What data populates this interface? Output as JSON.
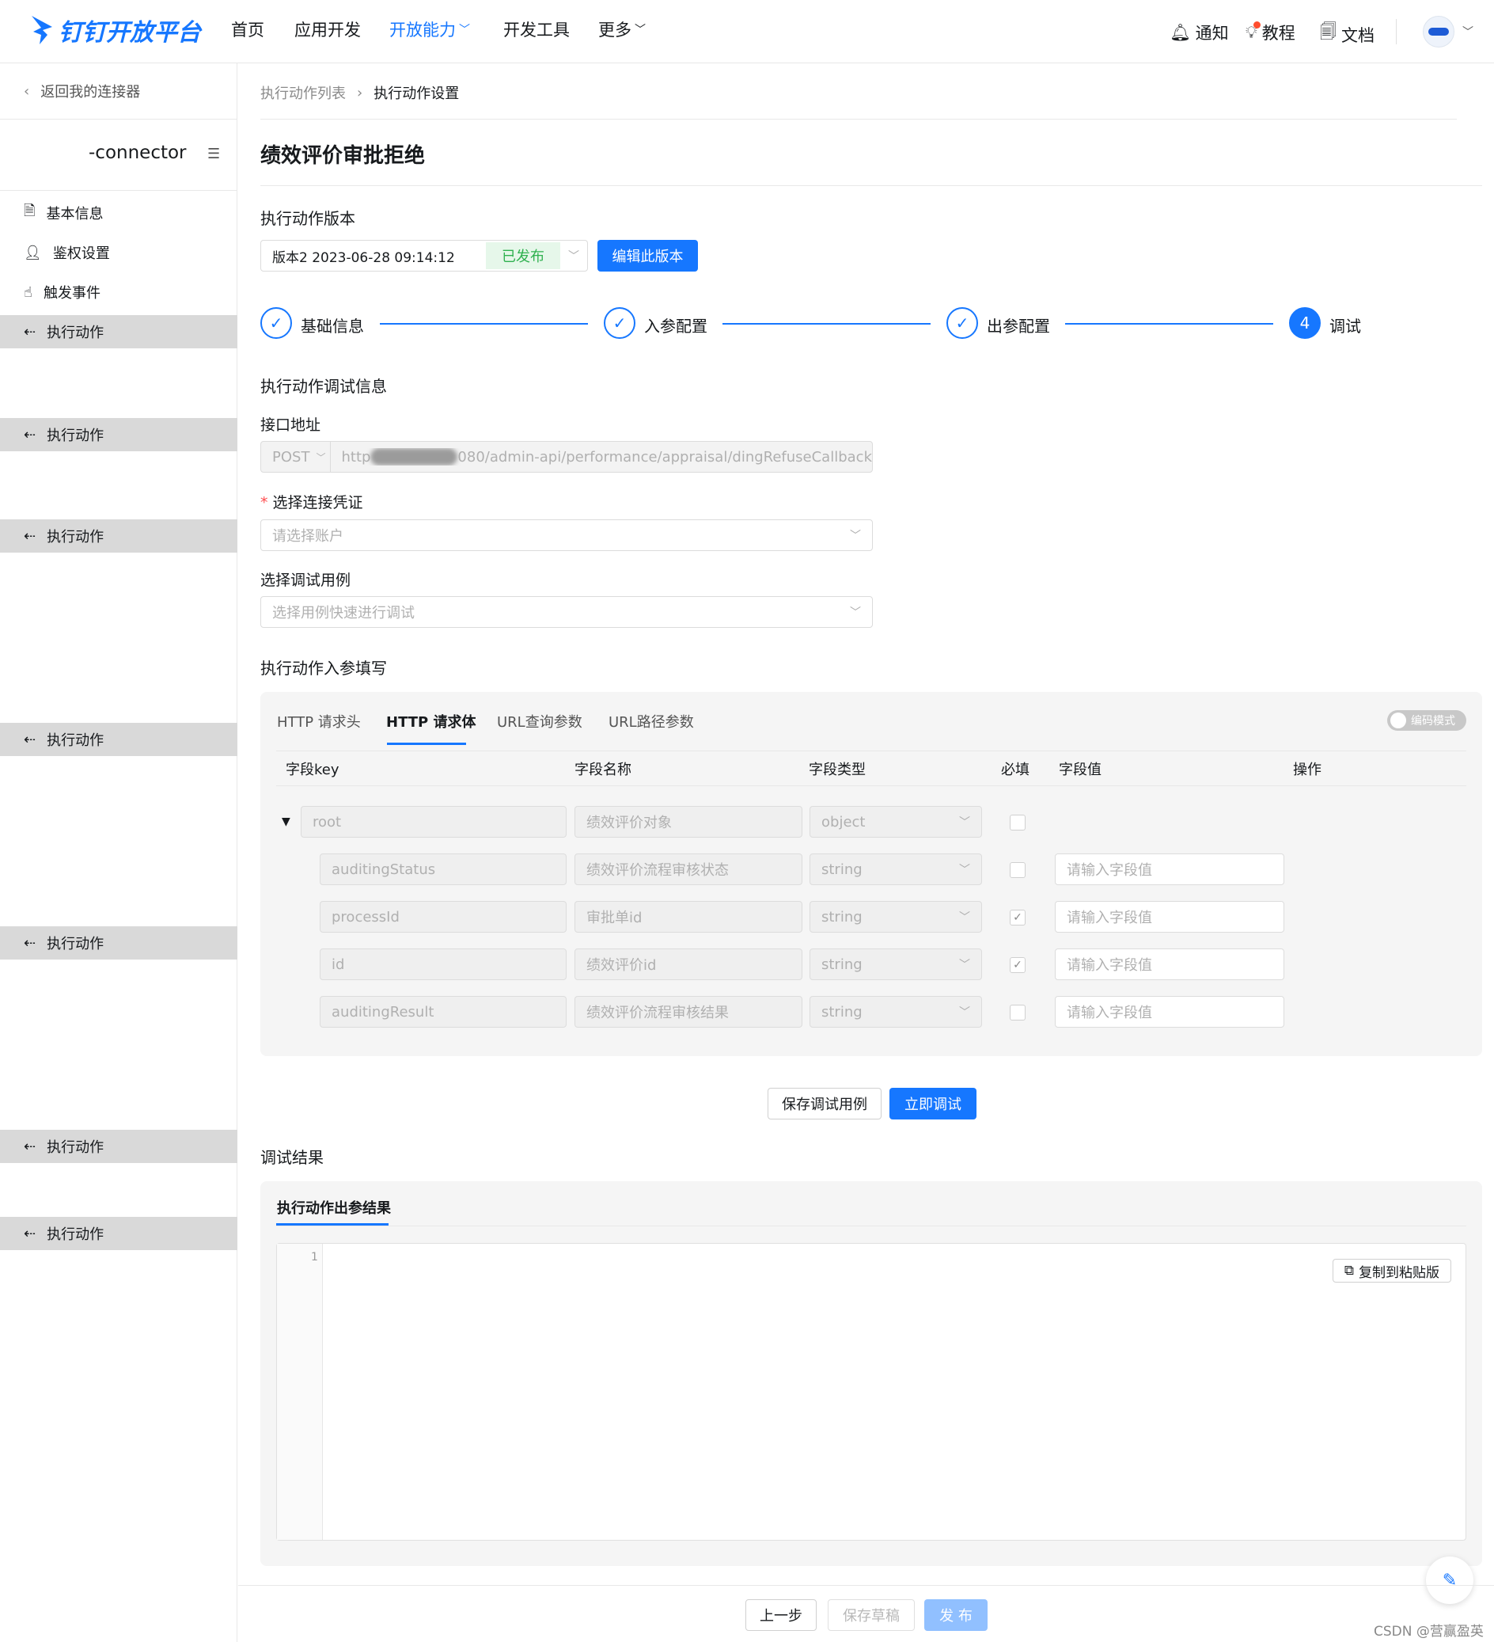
{
  "header": {
    "logo": "钉钉开放平台",
    "nav": [
      "首页",
      "应用开发",
      "开放能力",
      "开发工具",
      "更多"
    ],
    "notify": "通知",
    "tutorial": "教程",
    "docs": "文档"
  },
  "sidebar": {
    "back": "返回我的连接器",
    "connector_name": "-connector",
    "items": [
      "基本信息",
      "鉴权设置",
      "触发事件",
      "执行动作"
    ],
    "action_items": [
      "执行动作",
      "执行动作",
      "执行动作",
      "执行动作",
      "执行动作",
      "执行动作"
    ]
  },
  "breadcrumb": {
    "parent": "执行动作列表",
    "current": "执行动作设置"
  },
  "page_title": "绩效评价审批拒绝",
  "version": {
    "label": "执行动作版本",
    "value": "版本2 2023-06-28 09:14:12",
    "status": "已发布",
    "edit_button": "编辑此版本"
  },
  "steps": [
    {
      "label": "基础信息",
      "state": "done"
    },
    {
      "label": "入参配置",
      "state": "done"
    },
    {
      "label": "出参配置",
      "state": "done"
    },
    {
      "label": "调试",
      "number": "4",
      "state": "current"
    }
  ],
  "debug": {
    "section_title": "执行动作调试信息",
    "api_label": "接口地址",
    "method": "POST",
    "url_prefix": "http",
    "url_suffix": "080/admin-api/performance/appraisal/dingRefuseCallback",
    "credential_label": "选择连接凭证",
    "credential_placeholder": "请选择账户",
    "case_label": "选择调试用例",
    "case_placeholder": "选择用例快速进行调试",
    "params_title": "执行动作入参填写"
  },
  "tabs": [
    "HTTP 请求头",
    "HTTP 请求体",
    "URL查询参数",
    "URL路径参数"
  ],
  "code_mode": "编码模式",
  "table": {
    "headers": [
      "字段key",
      "字段名称",
      "字段类型",
      "必填",
      "字段值",
      "操作"
    ],
    "root": {
      "key": "root",
      "name": "绩效评价对象",
      "type": "object"
    },
    "rows": [
      {
        "key": "auditingStatus",
        "name": "绩效评价流程审核状态",
        "type": "string",
        "required": false,
        "placeholder": "请输入字段值"
      },
      {
        "key": "processId",
        "name": "审批单id",
        "type": "string",
        "required": true,
        "placeholder": "请输入字段值"
      },
      {
        "key": "id",
        "name": "绩效评价id",
        "type": "string",
        "required": true,
        "placeholder": "请输入字段值"
      },
      {
        "key": "auditingResult",
        "name": "绩效评价流程审核结果",
        "type": "string",
        "required": false,
        "placeholder": "请输入字段值"
      }
    ]
  },
  "actions": {
    "save_case": "保存调试用例",
    "run": "立即调试"
  },
  "result": {
    "title": "调试结果",
    "tab": "执行动作出参结果",
    "line_number": "1",
    "copy": "复制到粘贴版"
  },
  "footer": {
    "prev": "上一步",
    "save_draft": "保存草稿",
    "publish": "发 布"
  },
  "watermark": "CSDN @营赢盈英"
}
